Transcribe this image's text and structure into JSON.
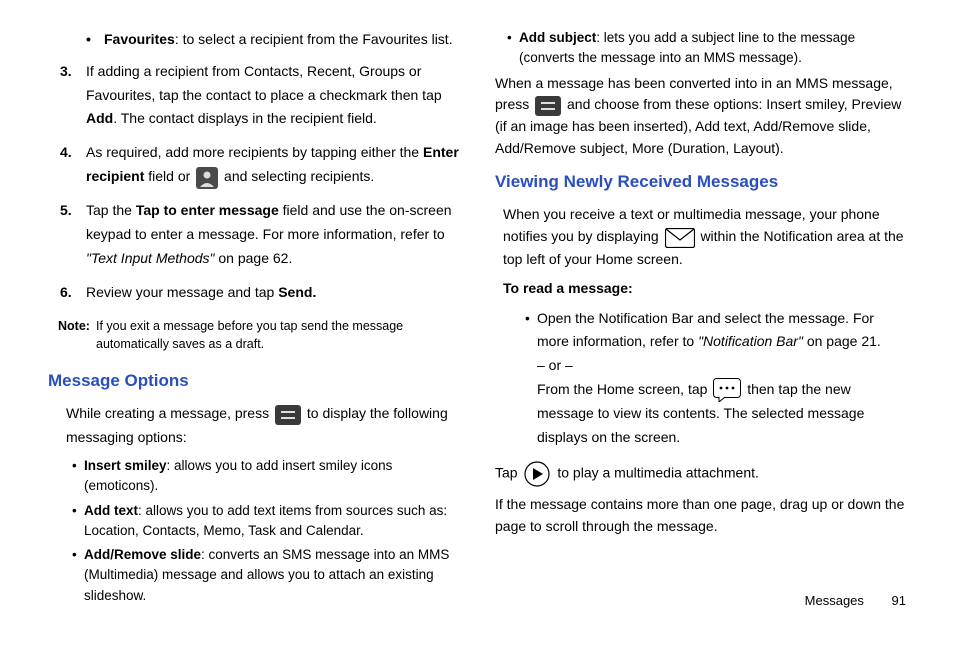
{
  "col1": {
    "fav_bullet_label": "Favourites",
    "fav_bullet_rest": ": to select a recipient from the Favourites list.",
    "step3_a": "If adding a recipient from Contacts, Recent, Groups or Favourites, tap the contact to place a checkmark then tap ",
    "step3_add": "Add",
    "step3_b": ". The contact displays in the recipient field.",
    "step4_a": "As required, add more recipients by tapping either the ",
    "step4_enter": "Enter recipient",
    "step4_b": " field or ",
    "step4_c": " and selecting recipients.",
    "step5_a": "Tap the ",
    "step5_bold": "Tap to enter message",
    "step5_b": " field and use the on-screen keypad to enter a message. For more information, refer to ",
    "step5_ital": "\"Text Input Methods\"",
    "step5_c": "  on page 62.",
    "step6_a": "Review your message and tap ",
    "step6_send": "Send.",
    "note_label": "Note:",
    "note_text": "If you exit a message before you tap send the message automatically saves as a draft.",
    "h_msgopt": "Message Options",
    "msgopt_para_a": "While creating a message, press ",
    "msgopt_para_b": " to display the following messaging options:",
    "opt1_label": "Insert smiley",
    "opt1_rest": ": allows you to add insert smiley icons (emoticons).",
    "opt2_label": "Add text",
    "opt2_rest": ": allows you to add text items from sources such as: Location, Contacts, Memo, Task and Calendar.",
    "opt3_label": "Add/Remove slide",
    "opt3_rest": ": converts an SMS message into an MMS (Multimedia) message and allows you to attach an existing slideshow."
  },
  "col2": {
    "opt4_label": "Add subject",
    "opt4_rest": ": lets you add a subject line to the message (converts the message into an MMS message).",
    "mms_a": "When a message has been converted into in an MMS message, press ",
    "mms_b": " and choose from these options: Insert smiley, Preview (if an image has been inserted), Add text, Add/Remove slide, Add/Remove subject, More (Duration, Layout).",
    "h_view": "Viewing Newly Received Messages",
    "view_a": "When you receive a text or multimedia message, your phone notifies you by displaying ",
    "view_b": " within the Notification area at the top left of your Home screen.",
    "read_label": "To read a message:",
    "read1_a": "Open the Notification Bar and select the message. For more information, refer to ",
    "read1_ital": "\"Notification Bar\"",
    "read1_b": "  on page 21.",
    "read_or": "– or –",
    "read2_a": "From the Home screen, tap ",
    "read2_b": " then tap the new message to view its contents. The selected message displays on the screen.",
    "play_a": "Tap ",
    "play_b": " to play a multimedia attachment.",
    "scroll": "If the message contains more than one page, drag up or down the page to scroll through the message."
  },
  "footer": {
    "section": "Messages",
    "page": "91"
  }
}
